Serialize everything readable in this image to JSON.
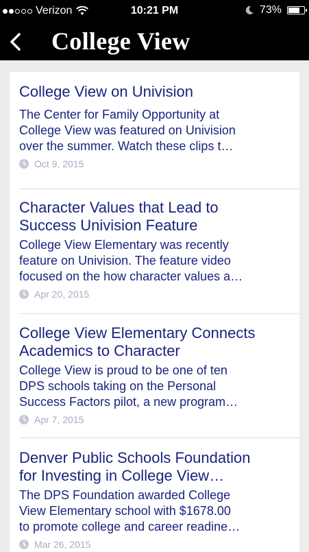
{
  "status": {
    "carrier": "Verizon",
    "time": "10:21 PM",
    "battery_text": "73%",
    "battery_level": 0.73,
    "signal_bars": 2
  },
  "nav": {
    "title": "College View",
    "back_icon": "chevron-left-icon"
  },
  "colors": {
    "accent": "#1a237e",
    "date": "#a6adc2",
    "bar": "#000000",
    "background": "#ededed"
  },
  "articles": [
    {
      "title_lines": [
        "College View on Univision"
      ],
      "excerpt_lines": [
        "The Center for Family Opportunity at",
        "College View was featured on Univision",
        "over the summer.  Watch these clips t…"
      ],
      "date": "Oct 9, 2015"
    },
    {
      "title_lines": [
        "Character Values that Lead to",
        "Success Univision Feature"
      ],
      "excerpt_lines": [
        "College View Elementary was recently",
        "feature on Univision. The feature video",
        "focused on the how character values a…"
      ],
      "date": "Apr 20, 2015"
    },
    {
      "title_lines": [
        "College View Elementary Connects",
        "Academics to Character"
      ],
      "excerpt_lines": [
        "College View is proud to be one of ten",
        "DPS schools taking on the Personal",
        "Success Factors pilot, a new program…"
      ],
      "date": "Apr 7, 2015"
    },
    {
      "title_lines": [
        "Denver Public Schools Foundation",
        "for Investing in College View…"
      ],
      "excerpt_lines": [
        "The DPS Foundation awarded College",
        "View Elementary school with $1678.00",
        "to promote college and career readine…"
      ],
      "date": "Mar 26, 2015"
    }
  ]
}
